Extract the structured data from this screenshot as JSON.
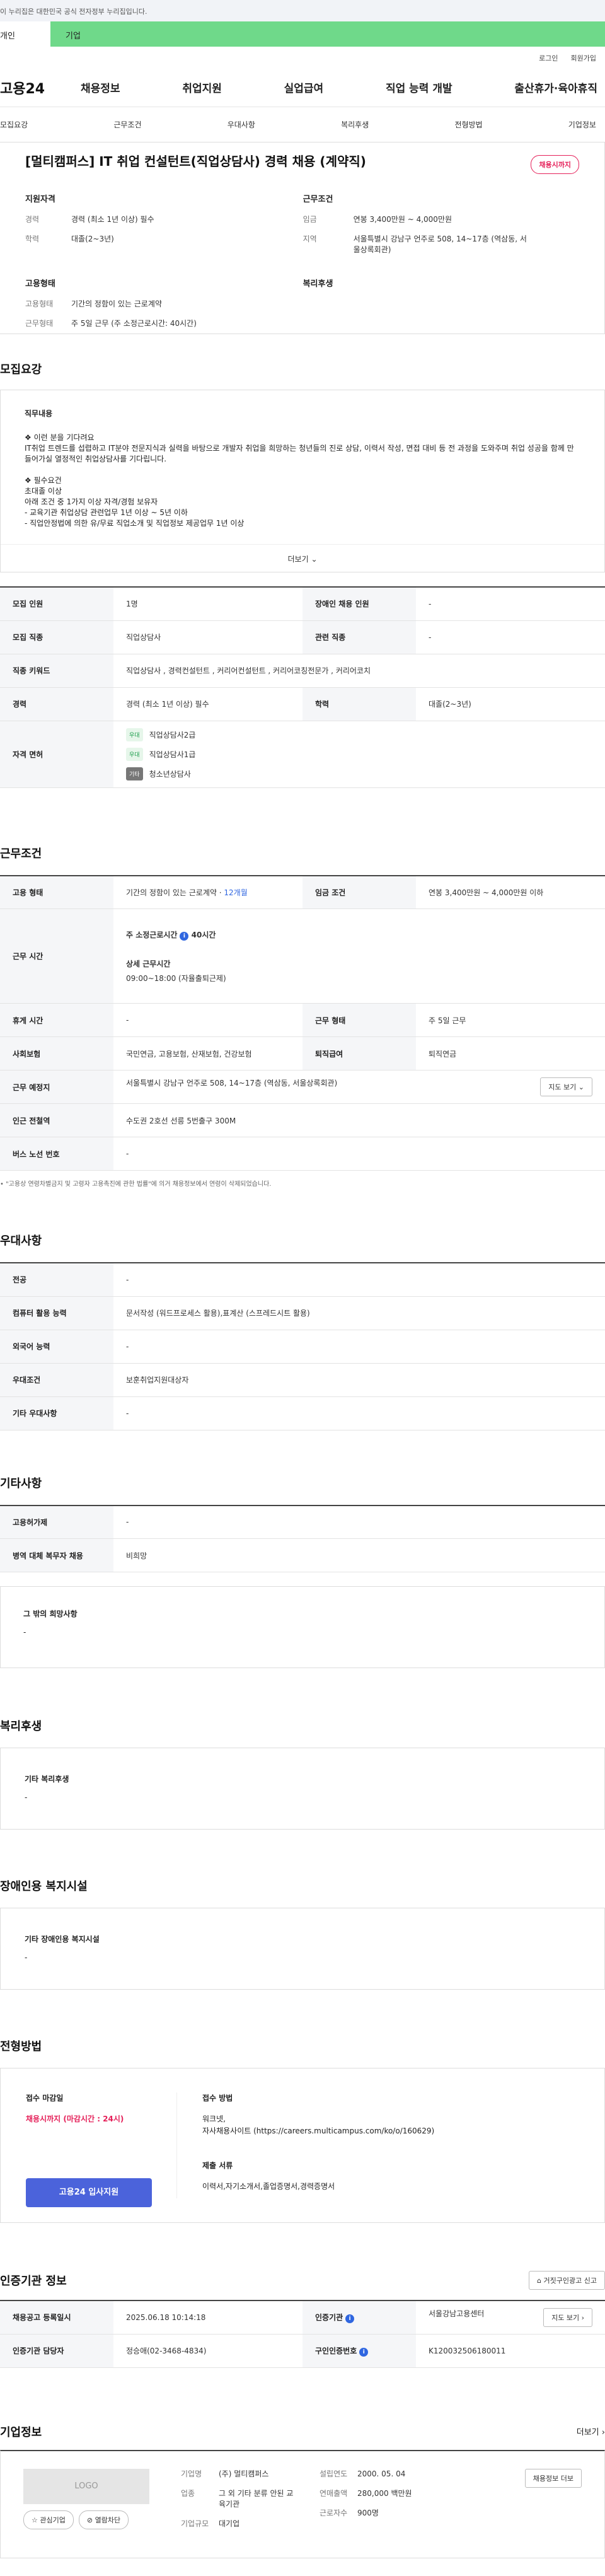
{
  "gov_notice": "이 누리집은 대한민국 공식 전자정부 누리집입니다.",
  "user_tabs": {
    "individual": "개인",
    "corporate": "기업"
  },
  "toplinks": [
    "로그인",
    "회원가입"
  ],
  "gnb": {
    "logo": "고용24",
    "menu": [
      "채용정보",
      "취업지원",
      "실업급여",
      "직업 능력 개발",
      "출산휴가·육아휴직"
    ]
  },
  "subnav": [
    "모집요강",
    "근무조건",
    "우대사항",
    "복리후생",
    "전형방법",
    "기업정보"
  ],
  "summary": {
    "title": "[멀티캠퍼스] IT 취업 컨설턴트(직업상담사) 경력 채용 (계약직)",
    "badge": "채용시까지",
    "qual_title": "지원자격",
    "cond_title": "근무조건",
    "emp_title": "고용형태",
    "welfare_title": "복리후생",
    "career_k": "경력",
    "career_v": "경력 (최소 1년 이상) 필수",
    "edu_k": "학력",
    "edu_v": "대졸(2~3년)",
    "wage_k": "임금",
    "wage_v": "연봉 3,400만원 ~ 4,000만원",
    "region_k": "지역",
    "region_v": "서울특별시 강남구 언주로 508, 14~17층 (역삼동, 서울상록회관)",
    "etype_k": "고용형태",
    "etype_v": "기간의 정함이 있는 근로계약",
    "wtype_k": "근무형태",
    "wtype_v": "주 5일 근무 (주 소정근로시간: 40시간)"
  },
  "recruit": {
    "title": "모집요강",
    "desc_title": "직무내용",
    "desc_body": "❖ 이런 분을 기다려요\nIT취업 트렌드를 섭렵하고 IT분야 전문지식과 실력을 바탕으로 개발자 취업을 희망하는 청년들의 진로 상담, 이력서 작성, 면접 대비 등 전 과정을 도와주며 취업 성공을 함께 만들어가실 열정적인 취업상담사를 기다립니다.\n\n❖ 필수요건\n 초대졸 이상\n 아래 조건 중 1가지 이상 자격/경험 보유자\n   - 교육기관 취업상담 관련업무 1년 이상 ~ 5년 이하\n   - 직업안정법에 의한 유/무료 직업소개 및 직업정보 제공업무 1년 이상",
    "more": "더보기",
    "rows": {
      "count_h": "모집 인원",
      "count_v": "1명",
      "disabled_h": "장애인 채용 인원",
      "disabled_v": "-",
      "job_h": "모집 직종",
      "job_v": "직업상담사",
      "related_h": "관련 직종",
      "related_v": "-",
      "kw_h": "직종 키워드",
      "kw_v": "직업상담사 , 경력컨설턴트 , 커리어컨설턴트 , 커리어코칭전문가 , 커리어코치",
      "career_h": "경력",
      "career_v": "경력 (최소 1년 이상) 필수",
      "edu_h": "학력",
      "edu_v": "대졸(2~3년)",
      "lic_h": "자격 면허",
      "licenses": [
        {
          "level": "우대",
          "name": "직업상담사2급"
        },
        {
          "level": "우대",
          "name": "직업상담사1급"
        },
        {
          "level": "기타",
          "name": "청소년상담사"
        }
      ]
    }
  },
  "work": {
    "title": "근무조건",
    "etype_h": "고용 형태",
    "etype_v": "기간의 정함이 있는 근로계약",
    "etype_period": "12개월",
    "wage_h": "임금 조건",
    "wage_v": "연봉 3,400만원 ~ 4,000만원 이하",
    "hours_h": "근무 시간",
    "hours_main": "주 소정근로시간",
    "hours_main_val": "40시간",
    "hours_detail_t": "상세 근무시간",
    "hours_detail_v": "09:00~18:00 (자율출퇴근제)",
    "rest_h": "휴게 시간",
    "rest_v": "-",
    "wform_h": "근무 형태",
    "wform_v": "주 5일 근무",
    "ins_h": "사회보험",
    "ins_v": "국민연금, 고용보험, 산재보험, 건강보험",
    "sev_h": "퇴직급여",
    "sev_v": "퇴직연금",
    "loc_h": "근무 예정지",
    "loc_v": "서울특별시 강남구 언주로 508, 14~17층 (역삼동, 서울상록회관)",
    "map_btn": "지도 보기",
    "subway_h": "인근 전철역",
    "subway_v": "수도권 2호선 선릉 5번출구 300M",
    "bus_h": "버스 노선 번호",
    "bus_v": "-",
    "note": "\"고용상 연령차별금지 및 고령자 고용촉진에 관한 법률\"에 의거 채용정보에서 연령이 삭제되었습니다."
  },
  "pref": {
    "title": "우대사항",
    "major_h": "전공",
    "major_v": "-",
    "pc_h": "컴퓨터 활용 능력",
    "pc_v": "문서작성 (워드프로세스 활용),표계산 (스프레드시트 활용)",
    "lang_h": "외국어 능력",
    "lang_v": "-",
    "cond_h": "우대조건",
    "cond_v": "보훈취업지원대상자",
    "etc_h": "기타 우대사항",
    "etc_v": "-"
  },
  "other": {
    "title": "기타사항",
    "permit_h": "고용허가제",
    "permit_v": "-",
    "mil_h": "병역 대체 복무자 채용",
    "mil_v": "비희망",
    "extra_t": "그 밖의 희망사항",
    "extra_v": "-"
  },
  "welfare": {
    "title": "복리후생",
    "box_t": "기타 복리후생",
    "box_v": "-"
  },
  "disability": {
    "title": "장애인용 복지시설",
    "box_t": "기타 장애인용 복지시설",
    "box_v": "-"
  },
  "process": {
    "title": "전형방법",
    "deadline_t": "접수 마감일",
    "deadline_v": "채용시까지 (마감시간 : 24시)",
    "apply_btn": "고용24 입사지원",
    "method_t": "접수 방법",
    "method_v": "워크넷,\n자사채용사이트 (https://careers.multicampus.com/ko/o/160629)",
    "docs_t": "제출 서류",
    "docs_v": "이력서,자기소개서,졸업증명서,경력증명서"
  },
  "agency": {
    "title": "인증기관 정보",
    "report_btn": "거짓구인광고 신고",
    "reg_h": "채용공고 등록일시",
    "reg_v": "2025.06.18 10:14:18",
    "org_h": "인증기관",
    "org_v": "서울강남고용센터",
    "map_btn": "지도 보기",
    "mgr_h": "인증기관 담당자",
    "mgr_v": "정승애(02-3468-4834)",
    "no_h": "구인인증번호",
    "no_v": "K120032506180011"
  },
  "company": {
    "title": "기업정보",
    "more": "더보기",
    "logo": "LOGO",
    "fav_btn": "관심기업",
    "block_btn": "열람차단",
    "name_k": "기업명",
    "name_v": "(주) 멀티캠퍼스",
    "ind_k": "업종",
    "ind_v": "그 외 기타 분류 안된 교육기관",
    "size_k": "기업규모",
    "size_v": "대기업",
    "est_k": "설립연도",
    "est_v": "2000. 05. 04",
    "sales_k": "연매출액",
    "sales_v": "280,000 백만원",
    "emp_k": "근로자수",
    "emp_v": "900명",
    "jobs_btn": "채용정보 더보",
    "info_i": "i"
  }
}
